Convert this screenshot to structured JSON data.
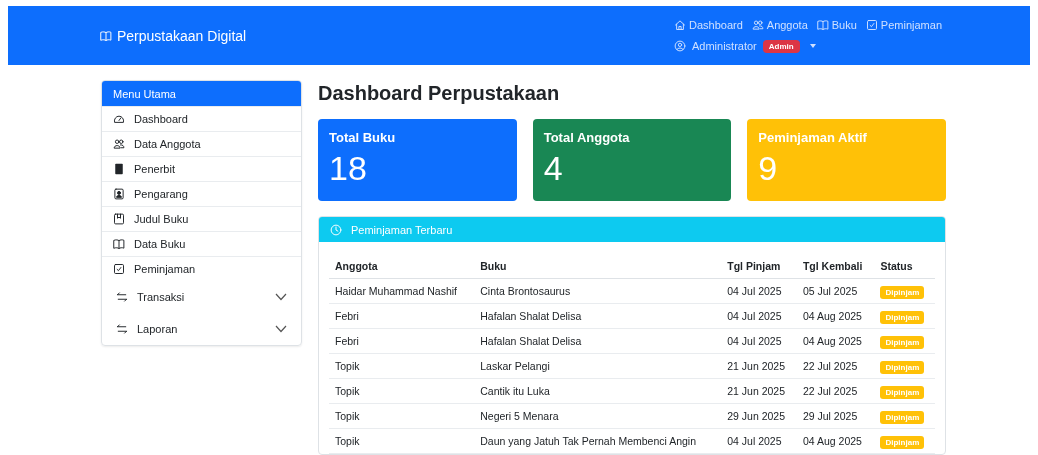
{
  "navbar": {
    "brand": "Perpustakaan Digital",
    "links": [
      {
        "label": "Dashboard"
      },
      {
        "label": "Anggota"
      },
      {
        "label": "Buku"
      },
      {
        "label": "Peminjaman"
      }
    ],
    "user": {
      "name": "Administrator",
      "role": "Admin"
    }
  },
  "sidebar": {
    "title": "Menu Utama",
    "items": [
      {
        "kind": "link",
        "label": "Dashboard"
      },
      {
        "kind": "link",
        "label": "Data Anggota"
      },
      {
        "kind": "link",
        "label": "Penerbit"
      },
      {
        "kind": "link",
        "label": "Pengarang"
      },
      {
        "kind": "link",
        "label": "Judul Buku"
      },
      {
        "kind": "link",
        "label": "Data Buku"
      },
      {
        "kind": "link",
        "label": "Peminjaman"
      },
      {
        "kind": "group",
        "label": "Transaksi",
        "expanded": false
      },
      {
        "kind": "group",
        "label": "Laporan",
        "expanded": false
      }
    ]
  },
  "heading": "Dashboard Perpustakaan",
  "stats": [
    {
      "label": "Total Buku",
      "value": "18",
      "color": "#0d6efd"
    },
    {
      "label": "Total Anggota",
      "value": "4",
      "color": "#198754"
    },
    {
      "label": "Peminjaman Aktif",
      "value": "9",
      "color": "#ffc107"
    }
  ],
  "recent": {
    "title": "Peminjaman Terbaru",
    "columns": [
      "Anggota",
      "Buku",
      "Tgl Pinjam",
      "Tgl Kembali",
      "Status"
    ],
    "rows": [
      [
        "Haidar Muhammad Nashif",
        "Cinta Brontosaurus",
        "04 Jul 2025",
        "05 Jul 2025",
        "Dipinjam"
      ],
      [
        "Febri",
        "Hafalan Shalat Delisa",
        "04 Jul 2025",
        "04 Aug 2025",
        "Dipinjam"
      ],
      [
        "Febri",
        "Hafalan Shalat Delisa",
        "04 Jul 2025",
        "04 Aug 2025",
        "Dipinjam"
      ],
      [
        "Topik",
        "Laskar Pelangi",
        "21 Jun 2025",
        "22 Jul 2025",
        "Dipinjam"
      ],
      [
        "Topik",
        "Cantik itu Luka",
        "21 Jun 2025",
        "22 Jul 2025",
        "Dipinjam"
      ],
      [
        "Topik",
        "Negeri 5 Menara",
        "29 Jun 2025",
        "29 Jul 2025",
        "Dipinjam"
      ],
      [
        "Topik",
        "Daun yang Jatuh Tak Pernah Membenci Angin",
        "04 Jul 2025",
        "04 Aug 2025",
        "Dipinjam"
      ]
    ]
  }
}
